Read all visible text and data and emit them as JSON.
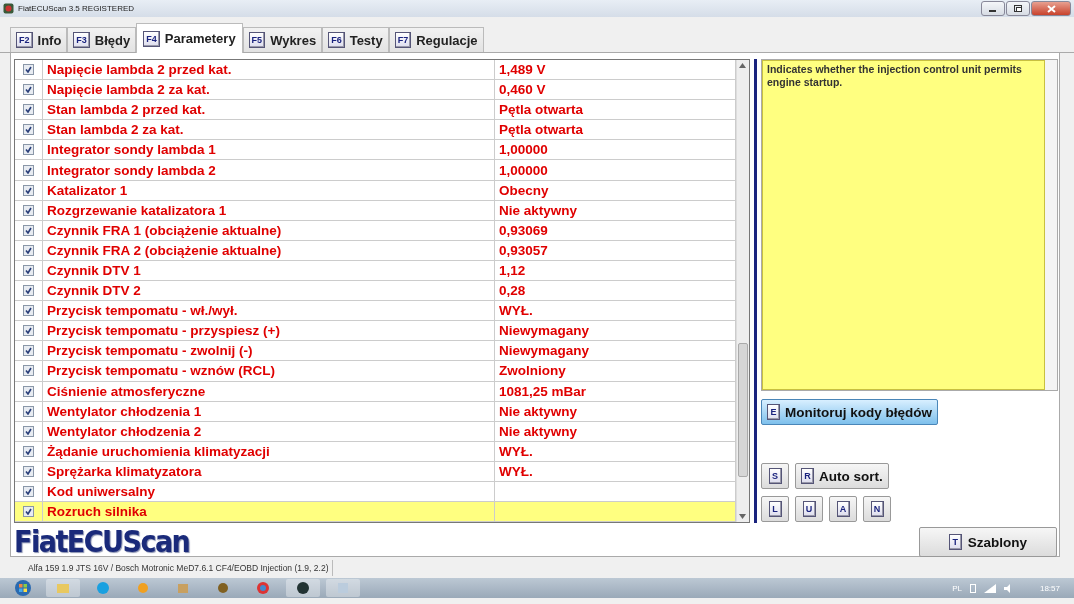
{
  "window": {
    "title": "FiatECUScan 3.5 REGISTERED"
  },
  "tabs": [
    {
      "key": "F2",
      "label": "Info",
      "selected": false
    },
    {
      "key": "F3",
      "label": "Błędy",
      "selected": false
    },
    {
      "key": "F4",
      "label": "Parametery",
      "selected": true
    },
    {
      "key": "F5",
      "label": "Wykres",
      "selected": false
    },
    {
      "key": "F6",
      "label": "Testy",
      "selected": false
    },
    {
      "key": "F7",
      "label": "Regulacje",
      "selected": false
    }
  ],
  "parameters": [
    {
      "checked": true,
      "selected": false,
      "name": "Napięcie lambda 2 przed kat.",
      "value": "1,489 V"
    },
    {
      "checked": true,
      "selected": false,
      "name": "Napięcie lambda 2 za kat.",
      "value": "0,460 V"
    },
    {
      "checked": true,
      "selected": false,
      "name": "Stan lambda 2 przed kat.",
      "value": "Pętla otwarta"
    },
    {
      "checked": true,
      "selected": false,
      "name": "Stan lambda 2 za kat.",
      "value": "Pętla otwarta"
    },
    {
      "checked": true,
      "selected": false,
      "name": "Integrator sondy lambda 1",
      "value": "1,00000"
    },
    {
      "checked": true,
      "selected": false,
      "name": "Integrator sondy lambda 2",
      "value": "1,00000"
    },
    {
      "checked": true,
      "selected": false,
      "name": "Katalizator 1",
      "value": "Obecny"
    },
    {
      "checked": true,
      "selected": false,
      "name": "Rozgrzewanie katalizatora 1",
      "value": "Nie aktywny"
    },
    {
      "checked": true,
      "selected": false,
      "name": "Czynnik FRA 1 (obciążenie aktualne)",
      "value": "0,93069"
    },
    {
      "checked": true,
      "selected": false,
      "name": "Czynnik FRA 2 (obciążenie aktualne)",
      "value": "0,93057"
    },
    {
      "checked": true,
      "selected": false,
      "name": "Czynnik DTV 1",
      "value": "1,12"
    },
    {
      "checked": true,
      "selected": false,
      "name": "Czynnik DTV 2",
      "value": "0,28"
    },
    {
      "checked": true,
      "selected": false,
      "name": "Przycisk tempomatu - wł./wył.",
      "value": "WYŁ."
    },
    {
      "checked": true,
      "selected": false,
      "name": "Przycisk tempomatu - przyspiesz (+)",
      "value": "Niewymagany"
    },
    {
      "checked": true,
      "selected": false,
      "name": "Przycisk tempomatu - zwolnij (-)",
      "value": "Niewymagany"
    },
    {
      "checked": true,
      "selected": false,
      "name": "Przycisk tempomatu - wznów (RCL)",
      "value": "Zwolniony"
    },
    {
      "checked": true,
      "selected": false,
      "name": "Ciśnienie atmosferyczne",
      "value": "1081,25 mBar"
    },
    {
      "checked": true,
      "selected": false,
      "name": "Wentylator chłodzenia 1",
      "value": "Nie aktywny"
    },
    {
      "checked": true,
      "selected": false,
      "name": "Wentylator chłodzenia 2",
      "value": "Nie aktywny"
    },
    {
      "checked": true,
      "selected": false,
      "name": "Żądanie uruchomienia klimatyzacji",
      "value": "WYŁ."
    },
    {
      "checked": true,
      "selected": false,
      "name": "Sprężarka klimatyzatora",
      "value": "WYŁ."
    },
    {
      "checked": true,
      "selected": false,
      "name": "Kod uniwersalny"
    },
    {
      "checked": true,
      "selected": true,
      "name": "Rozruch silnika"
    }
  ],
  "description": "Indicates whether the injection control unit permits engine startup.",
  "monitor_button": {
    "key": "E",
    "label": "Monitoruj kody błędów"
  },
  "sort_buttons": [
    {
      "key": "S"
    },
    {
      "key": "R",
      "label": "Auto sort."
    }
  ],
  "letter_buttons": [
    {
      "key": "L"
    },
    {
      "key": "U"
    },
    {
      "key": "A"
    },
    {
      "key": "N"
    }
  ],
  "templates_button": {
    "key": "T",
    "label": "Szablony"
  },
  "logo": "FiatECUScan",
  "status_bar": {
    "vehicle": "Alfa 159 1.9 JTS 16V / Bosch Motronic MeD7.6.1 CF4/EOBD Injection (1.9, 2.2)"
  },
  "taskbar": {
    "language": "PL",
    "time": "18:57"
  }
}
